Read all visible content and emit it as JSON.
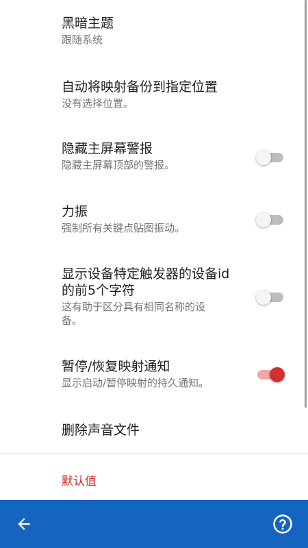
{
  "settings": {
    "dark_theme": {
      "title": "黑暗主题",
      "summary": "跟随系统"
    },
    "auto_backup": {
      "title": "自动将映射备份到指定位置",
      "summary": "没有选择位置。"
    },
    "hide_home_alert": {
      "title": "隐藏主屏幕警报",
      "summary": "隐藏主屏幕顶部的警报。",
      "enabled": false
    },
    "force_vibrate": {
      "title": "力振",
      "summary": "强制所有关键点贴图振动。",
      "enabled": false
    },
    "show_device_id": {
      "title_line1": "显示设备特定触发器的设备id",
      "title_line2": "的前5个字符",
      "summary_line1": "这有助于区分具有相同名称的设",
      "summary_line2": "备。",
      "enabled": false
    },
    "pause_notification": {
      "title": "暂停/恢复映射通知",
      "summary": "显示启动/暂停映射的持久通知。",
      "enabled": true
    },
    "delete_sounds": {
      "title": "删除声音文件"
    },
    "reset_defaults": {
      "label": "默认值"
    }
  },
  "bottom_bar": {
    "back_icon": "arrow-left-icon",
    "help_icon": "help-circle-icon"
  },
  "colors": {
    "accent": "#d32f2f",
    "bottom_bar": "#1565c0",
    "title_text": "#212121",
    "summary_text": "#757575"
  }
}
